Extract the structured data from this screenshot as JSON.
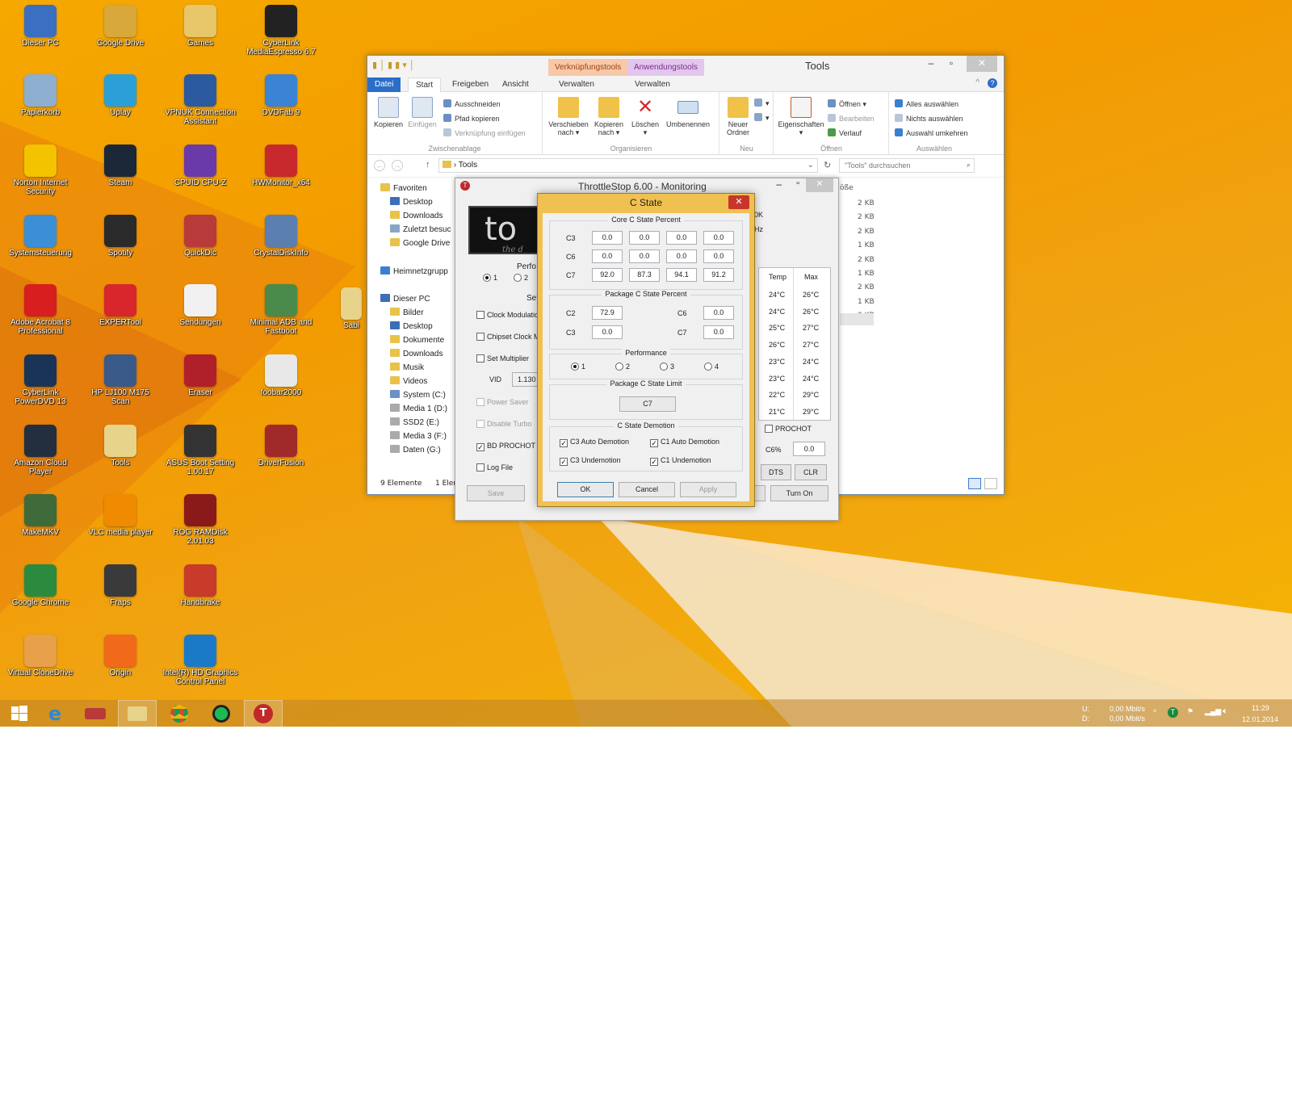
{
  "desktop": {
    "icons": [
      {
        "label": "Dieser PC",
        "color": "#3a6fc2"
      },
      {
        "label": "Google Drive",
        "color": "#d9a83a"
      },
      {
        "label": "Games",
        "color": "#e8c66a"
      },
      {
        "label": "CyberLink MediaEspresso 6.7",
        "color": "#222222"
      },
      {
        "label": "Papierkorb",
        "color": "#8eaed0"
      },
      {
        "label": "Uplay",
        "color": "#2aa0d6"
      },
      {
        "label": "VPNUK Connection Assistant",
        "color": "#2c5aa0"
      },
      {
        "label": "DVDFab 9",
        "color": "#3b83d4"
      },
      {
        "label": "Norton Internet Security",
        "color": "#f3c300"
      },
      {
        "label": "Steam",
        "color": "#1b2838"
      },
      {
        "label": "CPUID CPU-Z",
        "color": "#6a3aa8"
      },
      {
        "label": "HWMonitor_x64",
        "color": "#c8292c"
      },
      {
        "label": "Systemsteuerung",
        "color": "#3b8fd6"
      },
      {
        "label": "Spotify",
        "color": "#2a2a2a"
      },
      {
        "label": "QuickDic",
        "color": "#b83a3a"
      },
      {
        "label": "CrystalDiskInfo",
        "color": "#5b7fb0"
      },
      {
        "label": "Adobe Acrobat 8 Professional",
        "color": "#d81e1e"
      },
      {
        "label": "EXPERTool",
        "color": "#d8262c"
      },
      {
        "label": "Sendungen",
        "color": "#f1f1f1"
      },
      {
        "label": "Minimal ADB and Fastboot",
        "color": "#4a8a4a"
      },
      {
        "label": "CyberLink PowerDVD 13",
        "color": "#1a3458"
      },
      {
        "label": "HP LJ100 M175 Scan",
        "color": "#3a5a8a"
      },
      {
        "label": "Eraser",
        "color": "#b0202a"
      },
      {
        "label": "foobar2000",
        "color": "#e8e8e8"
      },
      {
        "label": "Amazon Cloud Player",
        "color": "#232f3e"
      },
      {
        "label": "Tools",
        "color": "#e8d38a"
      },
      {
        "label": "ASUS Boot Setting 1.00.17",
        "color": "#333333"
      },
      {
        "label": "DriverFusion",
        "color": "#a02a2a"
      },
      {
        "label": "MakeMKV",
        "color": "#3f6a3a"
      },
      {
        "label": "VLC media player",
        "color": "#f08a00"
      },
      {
        "label": "ROG RAMDisk 2.01.03",
        "color": "#8a1a1a"
      },
      {
        "label": "Google Chrome",
        "color": "#2b8a3e"
      },
      {
        "label": "Fraps",
        "color": "#3a3a3a"
      },
      {
        "label": "Handbrake",
        "color": "#c83a2a"
      },
      {
        "label": "Virtual CloneDrive",
        "color": "#e8a04a"
      },
      {
        "label": "Origin",
        "color": "#f06a1a"
      },
      {
        "label": "Intel(R) HD Graphics Control Panel",
        "color": "#1a7ac8"
      }
    ],
    "partial_icon_label": "Sabi"
  },
  "explorer": {
    "context_tab_1": "Verknüpfungstools",
    "context_tab_2": "Anwendungstools",
    "title": "Tools",
    "tabs": {
      "file": "Datei",
      "start": "Start",
      "share": "Freigeben",
      "view": "Ansicht",
      "manage1": "Verwalten",
      "manage2": "Verwalten"
    },
    "ribbon": {
      "copy": "Kopieren",
      "paste": "Einfügen",
      "cut": "Ausschneiden",
      "copy_path": "Pfad kopieren",
      "paste_shortcut": "Verknüpfung einfügen",
      "group_clipboard": "Zwischenablage",
      "move_to": "Verschieben nach",
      "copy_to": "Kopieren nach",
      "delete": "Löschen",
      "rename": "Umbenennen",
      "group_organize": "Organisieren",
      "new_folder": "Neuer Ordner",
      "group_new": "Neu",
      "properties": "Eigenschaften",
      "open": "Öffnen",
      "edit": "Bearbeiten",
      "history": "Verlauf",
      "group_open": "Öffnen",
      "select_all": "Alles auswählen",
      "select_none": "Nichts auswählen",
      "invert_selection": "Auswahl umkehren",
      "group_select": "Auswählen"
    },
    "address": "Tools",
    "search_placeholder": "\"Tools\" durchsuchen",
    "nav": {
      "favorites": "Favoriten",
      "desktop": "Desktop",
      "downloads": "Downloads",
      "recent": "Zuletzt besuc",
      "gdrive": "Google Drive",
      "homegroup": "Heimnetzgrupp",
      "thispc": "Dieser PC",
      "pictures": "Bilder",
      "desktop2": "Desktop",
      "documents": "Dokumente",
      "downloads2": "Downloads",
      "music": "Musik",
      "videos": "Videos",
      "sysc": "System (C:)",
      "media1": "Media 1 (D:)",
      "ssd2": "SSD2 (E:)",
      "media3": "Media 3 (F:)",
      "datag": "Daten (G:)"
    },
    "size_header": "öße",
    "sizes": [
      "2 KB",
      "2 KB",
      "2 KB",
      "1 KB",
      "2 KB",
      "1 KB",
      "2 KB",
      "1 KB",
      "2 KB"
    ],
    "status_items": "9 Elemente",
    "status_selected": "1 Eler"
  },
  "throttlestop": {
    "title": "ThrottleStop 6.00 - Monitoring",
    "perf_label": "Perfo",
    "radio_1": "1",
    "radio_2": "2",
    "set_label": "Set",
    "clock_mod": "Clock Modulation",
    "chipset_clock": "Chipset Clock M",
    "set_multiplier": "Set Multiplier",
    "vid_label": "VID",
    "vid_value": "1.130",
    "power_saver": "Power Saver",
    "disable_turbo": "Disable Turbo",
    "bd_prochot": "BD PROCHOT",
    "log_file": "Log File",
    "save": "Save",
    "right_ok": "0K",
    "right_hz": "Hz",
    "temp_header": "Temp",
    "max_header": "Max",
    "temps": [
      "24°C",
      "24°C",
      "25°C",
      "26°C",
      "23°C",
      "23°C",
      "22°C",
      "21°C"
    ],
    "maxes": [
      "26°C",
      "26°C",
      "27°C",
      "27°C",
      "24°C",
      "24°C",
      "29°C",
      "29°C"
    ],
    "prochot": "PROCHOT",
    "c6_label": "C6%",
    "c6_value": "0.0",
    "dts": "DTS",
    "clr": "CLR",
    "turn_on": "Turn On"
  },
  "cstate": {
    "title": "C State",
    "core_header": "Core C State Percent",
    "core_rows": [
      {
        "label": "C3",
        "values": [
          "0.0",
          "0.0",
          "0.0",
          "0.0"
        ]
      },
      {
        "label": "C6",
        "values": [
          "0.0",
          "0.0",
          "0.0",
          "0.0"
        ]
      },
      {
        "label": "C7",
        "values": [
          "92.0",
          "87.3",
          "94.1",
          "91.2"
        ]
      }
    ],
    "pkg_header": "Package C State Percent",
    "pkg": {
      "c2_label": "C2",
      "c2": "72.9",
      "c6_label": "C6",
      "c6": "0.0",
      "c3_label": "C3",
      "c3": "0.0",
      "c7_label": "C7",
      "c7": "0.0"
    },
    "perf_header": "Performance",
    "perf_options": [
      "1",
      "2",
      "3",
      "4"
    ],
    "limit_header": "Package C State Limit",
    "limit_value": "C7",
    "demotion_header": "C State Demotion",
    "c3_auto_demotion": "C3 Auto Demotion",
    "c1_auto_demotion": "C1 Auto Demotion",
    "c3_undemotion": "C3 Undemotion",
    "c1_undemotion": "C1 Undemotion",
    "ok": "OK",
    "cancel": "Cancel",
    "apply": "Apply"
  },
  "taskbar": {
    "net_u_label": "U:",
    "net_d_label": "D:",
    "net_u": "0,00 Mbit/s",
    "net_d": "0,00 Mbit/s",
    "time": "11:29",
    "date": "12.01.2014"
  }
}
